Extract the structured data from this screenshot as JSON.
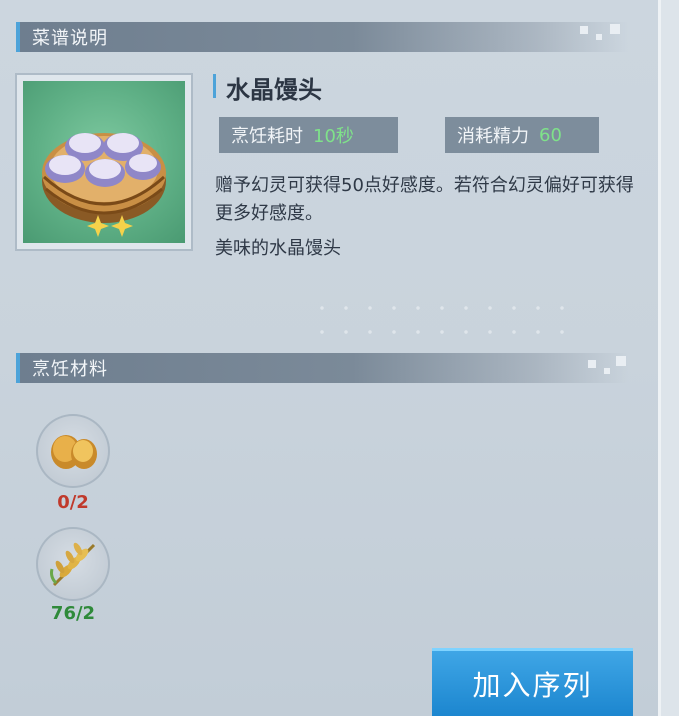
{
  "recipe_section": {
    "title": "菜谱说明"
  },
  "dish": {
    "name": "水晶馒头",
    "cook_time_label": "烹饪耗时",
    "cook_time_value": "10秒",
    "stamina_label": "消耗精力",
    "stamina_value": "60",
    "description": "赠予幻灵可获得50点好感度。若符合幻灵偏好可获得更多好感度。",
    "flavor": "美味的水晶馒头"
  },
  "materials_section": {
    "title": "烹饪材料"
  },
  "materials": [
    {
      "icon": "potato-icon",
      "count": "0/2",
      "color": "#c0392b"
    },
    {
      "icon": "wheat-icon",
      "count": "76/2",
      "color": "#2f8a3a"
    }
  ],
  "actions": {
    "add_to_queue": "加入序列"
  },
  "colors": {
    "accent": "#4da3d9",
    "button": "#1c86cf"
  }
}
